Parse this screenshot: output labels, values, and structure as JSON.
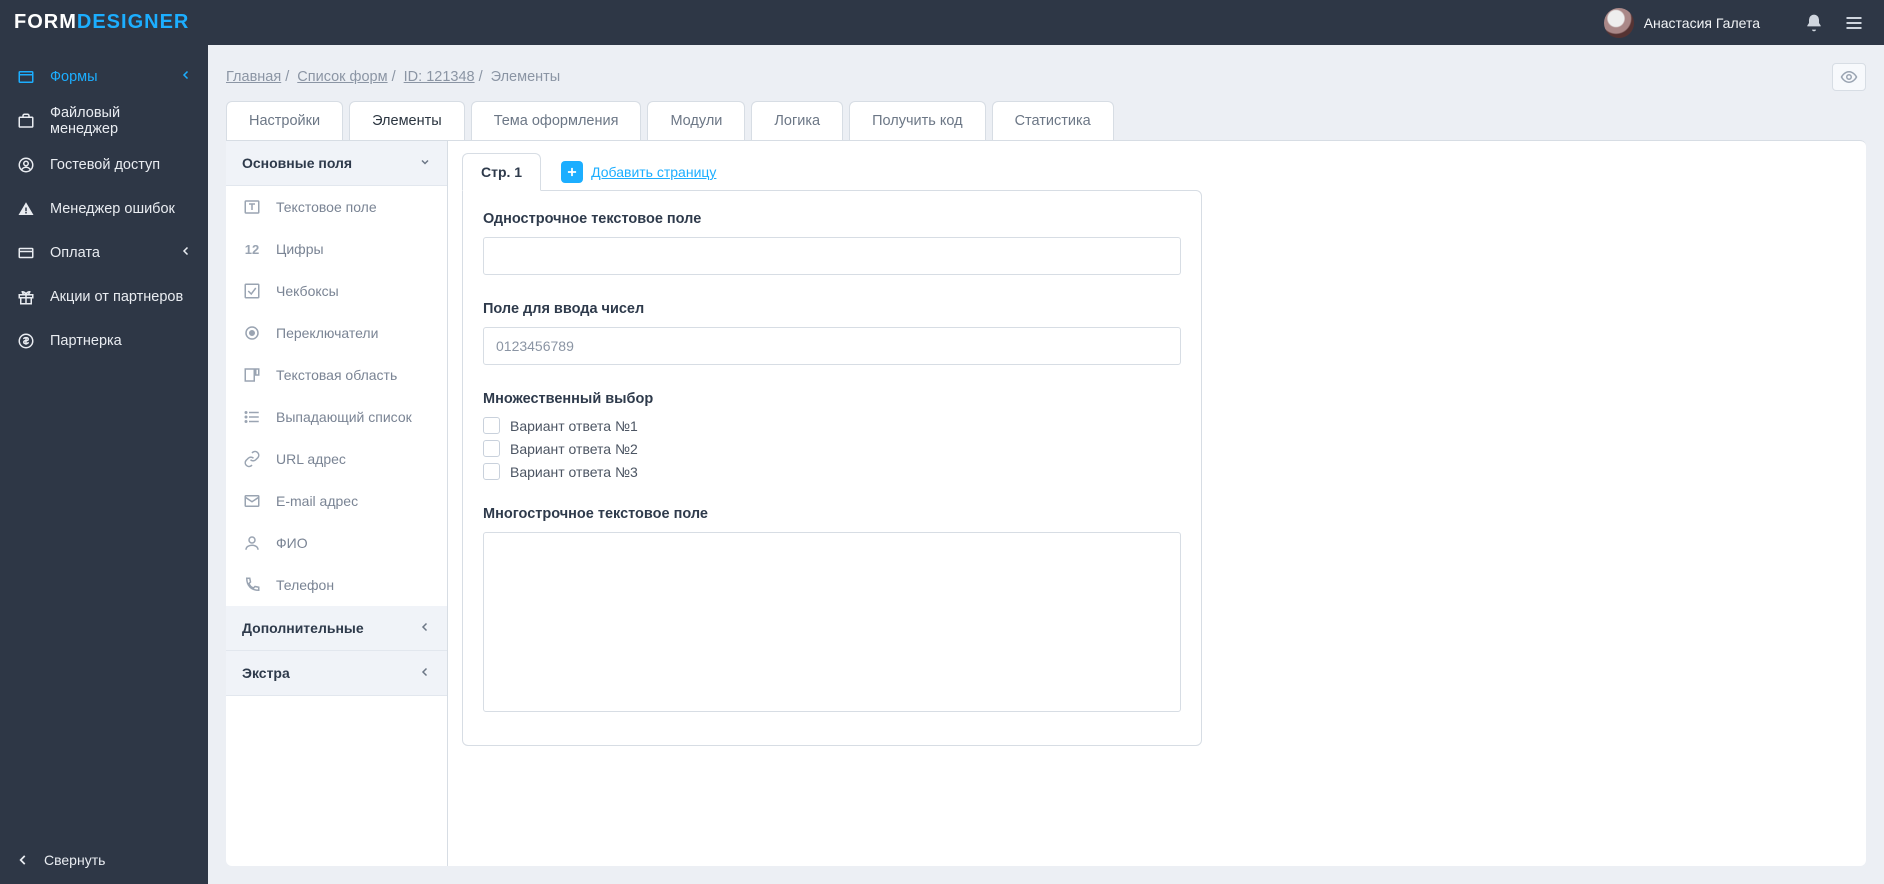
{
  "brand": {
    "part1": "FORM",
    "part2": "DESIGNER"
  },
  "user": {
    "name": "Анастасия Галета"
  },
  "sidebar": {
    "items": [
      {
        "label": "Формы",
        "icon": "forms",
        "active": true,
        "expandable": true
      },
      {
        "label": "Файловый менеджер",
        "icon": "files"
      },
      {
        "label": "Гостевой доступ",
        "icon": "guest"
      },
      {
        "label": "Менеджер ошибок",
        "icon": "errors"
      },
      {
        "label": "Оплата",
        "icon": "payment",
        "expandable": true
      },
      {
        "label": "Акции от партнеров",
        "icon": "gift"
      },
      {
        "label": "Партнерка",
        "icon": "partner"
      }
    ],
    "collapse_label": "Свернуть"
  },
  "breadcrumbs": [
    {
      "label": "Главная",
      "link": true
    },
    {
      "label": "Список форм",
      "link": true
    },
    {
      "label": "ID: 121348",
      "link": true
    },
    {
      "label": "Элементы",
      "link": false
    }
  ],
  "tabs": [
    {
      "label": "Настройки"
    },
    {
      "label": "Элементы",
      "active": true
    },
    {
      "label": "Тема оформления"
    },
    {
      "label": "Модули"
    },
    {
      "label": "Логика"
    },
    {
      "label": "Получить код"
    },
    {
      "label": "Статистика"
    }
  ],
  "palette": {
    "groups": [
      {
        "title": "Основные поля",
        "open": true,
        "items": [
          {
            "label": "Текстовое поле",
            "icon": "text"
          },
          {
            "label": "Цифры",
            "icon": "num"
          },
          {
            "label": "Чекбоксы",
            "icon": "check"
          },
          {
            "label": "Переключатели",
            "icon": "radio"
          },
          {
            "label": "Текстовая область",
            "icon": "textarea"
          },
          {
            "label": "Выпадающий список",
            "icon": "select"
          },
          {
            "label": "URL адрес",
            "icon": "url"
          },
          {
            "label": "E-mail адрес",
            "icon": "email"
          },
          {
            "label": "ФИО",
            "icon": "person"
          },
          {
            "label": "Телефон",
            "icon": "phone"
          }
        ]
      },
      {
        "title": "Дополнительные",
        "open": false
      },
      {
        "title": "Экстра",
        "open": false
      }
    ]
  },
  "canvas": {
    "page_tab": "Стр. 1",
    "add_page_label": "Добавить страницу",
    "fields": {
      "f1": {
        "label": "Однострочное текстовое поле",
        "value": ""
      },
      "f2": {
        "label": "Поле для ввода чисел",
        "placeholder": "0123456789",
        "value": ""
      },
      "f3": {
        "label": "Множественный выбор",
        "options": [
          "Вариант ответа №1",
          "Вариант ответа №2",
          "Вариант ответа №3"
        ]
      },
      "f4": {
        "label": "Многострочное текстовое поле",
        "value": ""
      }
    }
  }
}
